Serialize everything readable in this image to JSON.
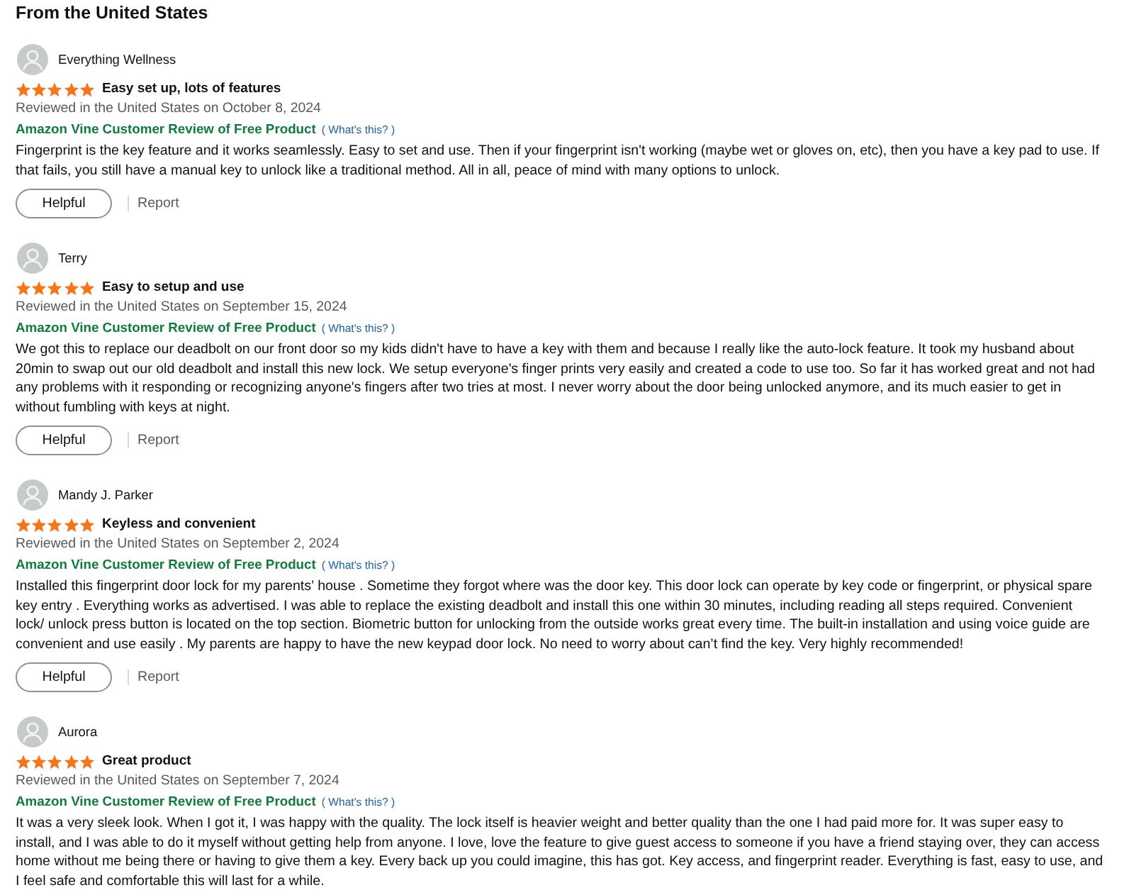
{
  "section_title": "From the United States",
  "reviews": [
    {
      "author": "Everything Wellness",
      "stars": 5,
      "title": "Easy set up, lots of features",
      "date": "Reviewed in the United States on October 8, 2024",
      "vine_label": "Amazon Vine Customer Review of Free Product",
      "vine_help": "( What's this? )",
      "body": "Fingerprint is the key feature and it works seamlessly. Easy to set and use. Then if your fingerprint isn't working (maybe wet or gloves on, etc), then you have a key pad to use. If that fails, you still have a manual key to unlock like a traditional method. All in all, peace of mind with many options to unlock.",
      "helpful_button": "Helpful",
      "report_link": "Report"
    },
    {
      "author": "Terry",
      "stars": 5,
      "title": "Easy to setup and use",
      "date": "Reviewed in the United States on September 15, 2024",
      "vine_label": "Amazon Vine Customer Review of Free Product",
      "vine_help": "( What's this? )",
      "body": "We got this to replace our deadbolt on our front door so my kids didn't have to have a key with them and because I really like the auto-lock feature. It took my husband about 20min to swap out our old deadbolt and install this new lock. We setup everyone's finger prints very easily and created a code to use too. So far it has worked great and not had any problems with it responding or recognizing anyone's fingers after two tries at most. I never worry about the door being unlocked anymore, and its much easier to get in without fumbling with keys at night.",
      "helpful_button": "Helpful",
      "report_link": "Report"
    },
    {
      "author": "Mandy J. Parker",
      "stars": 5,
      "title": "Keyless and convenient",
      "date": "Reviewed in the United States on September 2, 2024",
      "vine_label": "Amazon Vine Customer Review of Free Product",
      "vine_help": "( What's this? )",
      "body": "Installed this fingerprint door lock for my parents’ house . Sometime they forgot where was the door key. This door lock can operate by key code or fingerprint, or physical spare key entry . Everything works as advertised. I was able to replace the existing deadbolt and install this one within 30 minutes, including reading all steps required. Convenient lock/ unlock press button is located on the top section. Biometric button for unlocking from the outside works great every time. The built-in installation and using voice guide are convenient and use easily . My parents are happy to have the new keypad door lock. No need to worry about can’t find the key. Very highly recommended!",
      "helpful_button": "Helpful",
      "report_link": "Report"
    },
    {
      "author": "Aurora",
      "stars": 5,
      "title": "Great product",
      "date": "Reviewed in the United States on September 7, 2024",
      "vine_label": "Amazon Vine Customer Review of Free Product",
      "vine_help": "( What's this? )",
      "body": "It was a very sleek look. When I got it, I was happy with the quality. The lock itself is heavier weight and better quality than the one I had paid more for. It was super easy to install, and I was able to do it myself without getting help from anyone. I love, love the feature to give guest access to someone if you have a friend staying over, they can access home without me being there or having to give them a key. Every back up you could imagine, this has got. Key access, and fingerprint reader. Everything is fast, easy to use, and I feel safe and comfortable this will last for a while."
    }
  ]
}
